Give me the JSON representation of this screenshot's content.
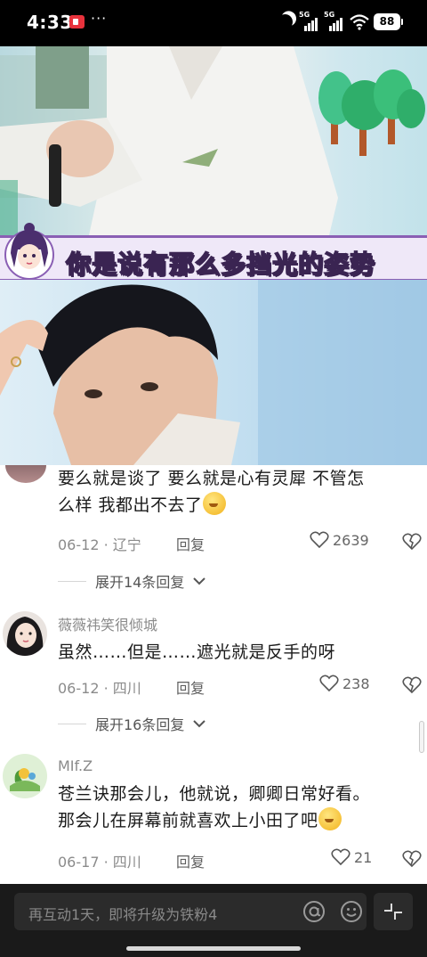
{
  "status_bar": {
    "time": "4:33",
    "signal_1_label": "5G",
    "signal_2_label": "5G",
    "battery": "88"
  },
  "video": {
    "subtitle": "你是说有那么多挡光的姿势"
  },
  "comments": [
    {
      "text_line1": "要么就是谈了  要么就是心有灵犀  不管怎",
      "text_line2": "么样  我都出不去了",
      "date": "06-12",
      "location": "辽宁",
      "reply_label": "回复",
      "likes": "2639",
      "expand_label": "展开14条回复"
    },
    {
      "username": "薇薇祎笑很倾城",
      "text_line1": "虽然……但是……遮光就是反手的呀",
      "date": "06-12",
      "location": "四川",
      "reply_label": "回复",
      "likes": "238",
      "expand_label": "展开16条回复"
    },
    {
      "username": "MIf.Z",
      "text_line1": "苍兰诀那会儿，他就说，卿卿日常好看。",
      "text_line2": "那会儿在屏幕前就喜欢上小田了吧",
      "date": "06-17",
      "location": "四川",
      "reply_label": "回复",
      "likes": "21"
    }
  ],
  "input": {
    "placeholder": "再互动1天，即将升级为铁粉4"
  },
  "icons": [
    "recording-icon",
    "moon-icon",
    "wifi-icon",
    "heart-icon",
    "broken-heart-icon",
    "chevron-down-icon",
    "at-icon",
    "emoji-icon",
    "collapse-icon"
  ],
  "colors": {
    "subtitle_border": "#8a5fb4",
    "input_bg": "#1a1a1a"
  }
}
